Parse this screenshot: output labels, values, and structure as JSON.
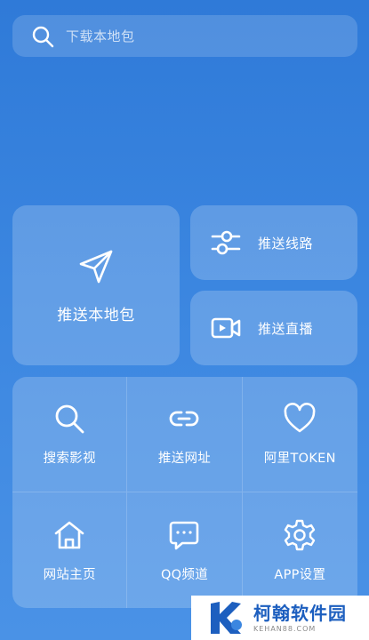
{
  "search": {
    "placeholder": "下载本地包",
    "icon": "search-icon"
  },
  "primary": {
    "label": "推送本地包",
    "icon": "send-icon"
  },
  "side": [
    {
      "label": "推送线路",
      "icon": "sliders-icon"
    },
    {
      "label": "推送直播",
      "icon": "video-icon"
    }
  ],
  "grid": [
    {
      "label": "搜索影视",
      "icon": "search-icon"
    },
    {
      "label": "推送网址",
      "icon": "link-icon"
    },
    {
      "label": "阿里TOKEN",
      "icon": "heart-icon"
    },
    {
      "label": "网站主页",
      "icon": "home-icon"
    },
    {
      "label": "QQ频道",
      "icon": "chat-icon"
    },
    {
      "label": "APP设置",
      "icon": "gear-icon"
    }
  ],
  "watermark": {
    "brand": "柯翰软件园",
    "url": "KEHAN88.COM"
  },
  "colors": {
    "background": "#3b86e0",
    "card": "rgba(255,255,255,0.2)",
    "brand": "#1d5fbf"
  }
}
